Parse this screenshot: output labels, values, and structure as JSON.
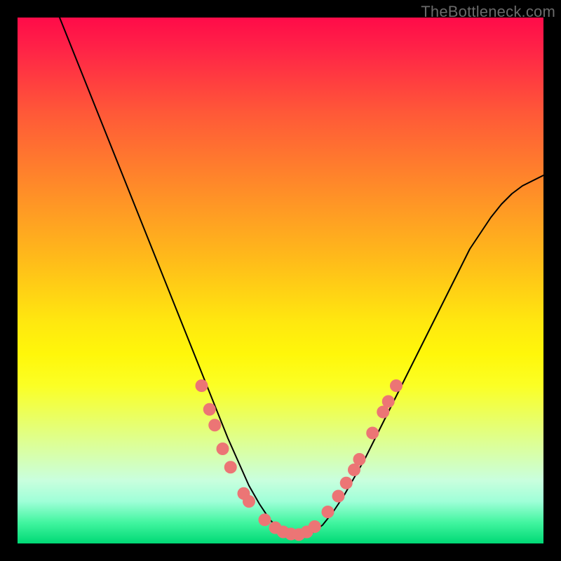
{
  "watermark": "TheBottleneck.com",
  "chart_data": {
    "type": "line",
    "title": "",
    "xlabel": "",
    "ylabel": "",
    "xlim": [
      0,
      100
    ],
    "ylim": [
      0,
      100
    ],
    "grid": false,
    "legend": false,
    "series": [
      {
        "name": "curve",
        "x": [
          8,
          10,
          12,
          14,
          16,
          18,
          20,
          22,
          24,
          26,
          28,
          30,
          32,
          34,
          36,
          38,
          40,
          42,
          44,
          46,
          48,
          50,
          52,
          54,
          56,
          58,
          60,
          62,
          64,
          66,
          68,
          70,
          72,
          74,
          76,
          78,
          80,
          82,
          84,
          86,
          88,
          90,
          92,
          94,
          96,
          98,
          100
        ],
        "y": [
          100,
          95,
          90,
          85,
          80,
          75,
          70,
          65,
          60,
          55,
          50,
          45,
          40,
          35,
          30,
          25,
          20,
          15.5,
          11,
          7.5,
          4.5,
          2.5,
          1.5,
          1.5,
          2.0,
          3.5,
          6,
          9,
          12.5,
          16,
          20,
          24,
          28,
          32,
          36,
          40,
          44,
          48,
          52,
          56,
          59,
          62,
          64.5,
          66.5,
          68,
          69,
          70
        ]
      }
    ],
    "markers": [
      {
        "x": 35.0,
        "y": 30.0
      },
      {
        "x": 36.5,
        "y": 25.5
      },
      {
        "x": 37.5,
        "y": 22.5
      },
      {
        "x": 39.0,
        "y": 18.0
      },
      {
        "x": 40.5,
        "y": 14.5
      },
      {
        "x": 43.0,
        "y": 9.5
      },
      {
        "x": 44.0,
        "y": 8.0
      },
      {
        "x": 47.0,
        "y": 4.5
      },
      {
        "x": 49.0,
        "y": 3.0
      },
      {
        "x": 50.5,
        "y": 2.2
      },
      {
        "x": 52.0,
        "y": 1.8
      },
      {
        "x": 53.5,
        "y": 1.7
      },
      {
        "x": 55.0,
        "y": 2.2
      },
      {
        "x": 56.5,
        "y": 3.2
      },
      {
        "x": 59.0,
        "y": 6.0
      },
      {
        "x": 61.0,
        "y": 9.0
      },
      {
        "x": 62.5,
        "y": 11.5
      },
      {
        "x": 64.0,
        "y": 14.0
      },
      {
        "x": 65.0,
        "y": 16.0
      },
      {
        "x": 67.5,
        "y": 21.0
      },
      {
        "x": 69.5,
        "y": 25.0
      },
      {
        "x": 70.5,
        "y": 27.0
      },
      {
        "x": 72.0,
        "y": 30.0
      }
    ],
    "marker_style": {
      "color": "#ec7575",
      "radius_px": 9
    },
    "background_gradient": {
      "top": "#ff0b49",
      "bottom": "#00d975"
    }
  }
}
